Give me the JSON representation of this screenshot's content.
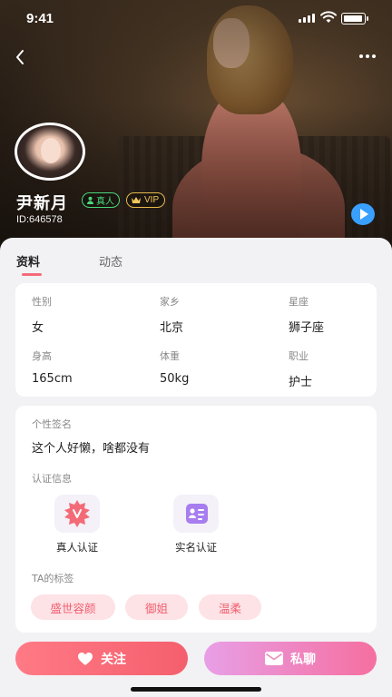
{
  "status_bar": {
    "time": "9:41"
  },
  "profile": {
    "name": "尹新月",
    "badge_real": "真人",
    "badge_vip": "VIP",
    "id": "ID:646578"
  },
  "tabs": [
    {
      "label": "资料",
      "active": true
    },
    {
      "label": "动态",
      "active": false
    }
  ],
  "info": [
    {
      "label": "性别",
      "value": "女"
    },
    {
      "label": "家乡",
      "value": "北京"
    },
    {
      "label": "星座",
      "value": "狮子座"
    },
    {
      "label": "身高",
      "value": "165cm"
    },
    {
      "label": "体重",
      "value": "50kg"
    },
    {
      "label": "职业",
      "value": "护士"
    }
  ],
  "signature": {
    "title": "个性签名",
    "text": "这个人好懒，啥都没有"
  },
  "verification": {
    "title": "认证信息",
    "items": [
      {
        "label": "真人认证",
        "icon": "real-person-verify-icon"
      },
      {
        "label": "实名认证",
        "icon": "id-card-verify-icon"
      }
    ]
  },
  "tags": {
    "title": "TA的标签",
    "items": [
      "盛世容颜",
      "御姐",
      "温柔"
    ]
  },
  "actions": {
    "follow_label": "关注",
    "chat_label": "私聊"
  },
  "colors": {
    "accent": "#f56b7a",
    "tag_bg": "#fde2e6",
    "real_badge": "#4ad67c",
    "vip_badge": "#e7b94a"
  }
}
